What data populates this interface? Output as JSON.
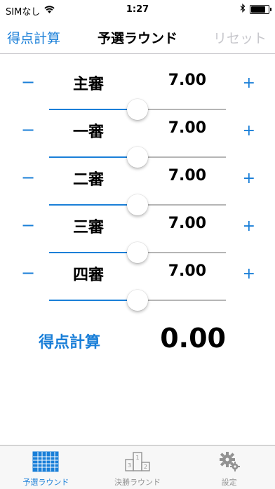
{
  "status": {
    "carrier": "SIMなし",
    "time": "1:27",
    "battery_level": 0.85
  },
  "nav": {
    "left_label": "得点計算",
    "title": "予選ラウンド",
    "right_label": "リセット"
  },
  "controls": {
    "minus": "−",
    "plus": "+"
  },
  "judges": [
    {
      "label": "主審",
      "value": "7.00",
      "level": 0.5
    },
    {
      "label": "一審",
      "value": "7.00",
      "level": 0.5
    },
    {
      "label": "二審",
      "value": "7.00",
      "level": 0.5
    },
    {
      "label": "三審",
      "value": "7.00",
      "level": 0.5
    },
    {
      "label": "四審",
      "value": "7.00",
      "level": 0.5
    }
  ],
  "score": {
    "button_label": "得点計算",
    "value": "0.00"
  },
  "tabs": [
    {
      "label": "予選ラウンド",
      "icon": "grid-icon",
      "active": true
    },
    {
      "label": "決勝ラウンド",
      "icon": "podium-icon",
      "active": false
    },
    {
      "label": "設定",
      "icon": "gear-icon",
      "active": false
    }
  ],
  "colors": {
    "accent": "#1a7fd8",
    "track": "#b5b5b5",
    "disabled": "#c7c7cc"
  }
}
